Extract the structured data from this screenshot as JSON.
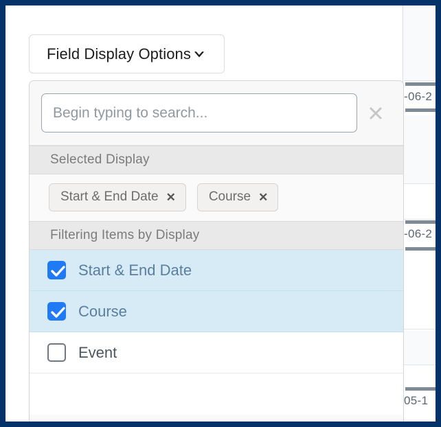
{
  "window": {
    "frame_color": "#043269"
  },
  "trigger": {
    "label": "Field Display Options",
    "icon": "chevron-down-icon"
  },
  "dropdown": {
    "search": {
      "placeholder": "Begin typing to search...",
      "value": "",
      "clear_icon": "close-icon"
    },
    "selected_display": {
      "header": "Selected Display",
      "chips": [
        {
          "label": "Start & End Date",
          "remove": "✕"
        },
        {
          "label": "Course",
          "remove": "✕"
        }
      ]
    },
    "filtering": {
      "header": "Filtering Items by Display",
      "options": [
        {
          "label": "Start & End Date",
          "checked": true
        },
        {
          "label": "Course",
          "checked": true
        },
        {
          "label": "Event",
          "checked": false
        }
      ]
    }
  },
  "background": {
    "rows": [
      {
        "date": "-06-2"
      },
      {
        "date": "-06-2"
      },
      {
        "date": "05-1"
      }
    ]
  },
  "colors": {
    "accent_checkbox": "#2079f5",
    "row_selected": "#d6ebf5",
    "section_header_bg": "#e9e9e9",
    "frame": "#043269"
  }
}
